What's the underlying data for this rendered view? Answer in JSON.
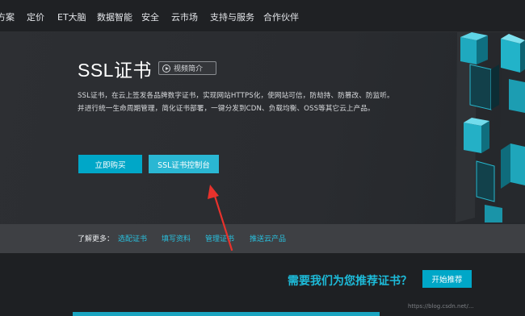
{
  "nav": {
    "items": [
      "方案",
      "定价",
      "ET大脑",
      "数据智能",
      "安全",
      "云市场",
      "支持与服务",
      "合作伙伴"
    ]
  },
  "hero": {
    "title": "SSL证书",
    "video_label": "视频简介",
    "desc_line1": "SSL证书，在云上签发各品牌数字证书，实现网站HTTPS化，使网站可信，防劫持、防篡改、防监听。",
    "desc_line2": "并进行统一生命周期管理，简化证书部署，一键分发到CDN、负载均衡、OSS等其它云上产品。",
    "buy_label": "立即购买",
    "console_label": "SSL证书控制台"
  },
  "learn_more": {
    "label": "了解更多：",
    "links": [
      "选配证书",
      "填写资料",
      "管理证书",
      "推送云产品"
    ]
  },
  "recommend": {
    "question": "需要我们为您推荐证书？",
    "start_label": "开始推荐"
  },
  "watermark": "https://blog.csdn.net/...",
  "colors": {
    "accent": "#00a7c8",
    "link": "#29c0de",
    "arrow": "#e8322c"
  }
}
